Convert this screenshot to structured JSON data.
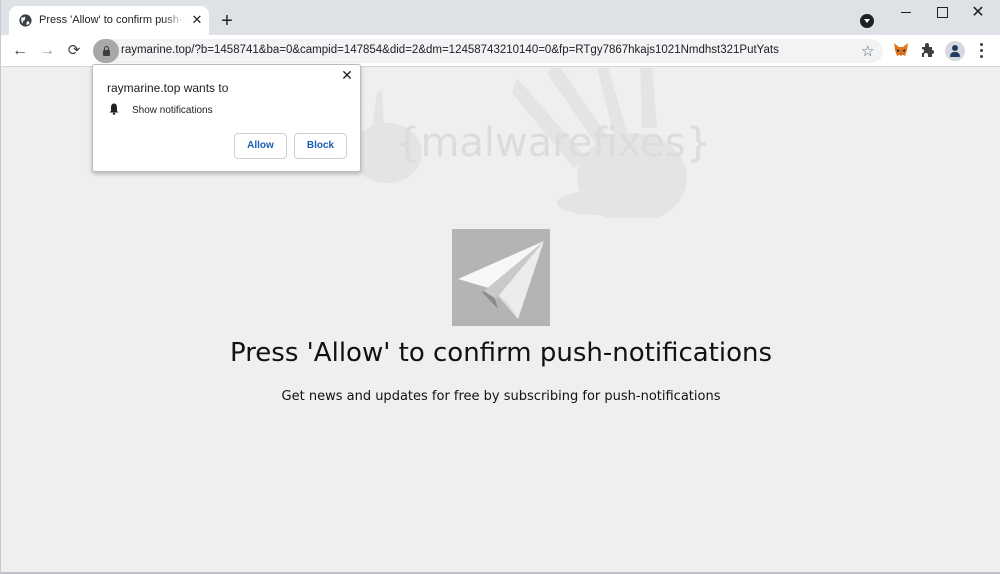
{
  "browser": {
    "tab": {
      "title": "Press 'Allow' to confirm push-notifications",
      "favicon": "globe-icon",
      "close_glyph": "✕"
    },
    "new_tab_glyph": "+",
    "window_controls": {
      "minimize": "minimize-icon",
      "maximize": "maximize-icon",
      "close_glyph": "✕"
    },
    "toolbar": {
      "back_glyph": "←",
      "forward_glyph": "→",
      "reload_glyph": "⟳",
      "url": "raymarine.top/?b=1458741&ba=0&campid=147854&did=2&dm=12458743210140=0&fp=RTgy7867hkajs1021Nmdhst321PutYats",
      "bookmark_glyph": "☆",
      "extensions": [
        "metamask-fox-icon",
        "puzzle-extensions-icon"
      ],
      "profile": "profile-avatar-icon",
      "menu": "kebab-menu-icon"
    }
  },
  "permission_popup": {
    "title": "raymarine.top wants to",
    "item_icon": "bell-icon",
    "item_label": "Show notifications",
    "allow_label": "Allow",
    "block_label": "Block",
    "close_glyph": "✕",
    "button_text_color": "#1a5fb4"
  },
  "page": {
    "watermark": "{malwarefixes}",
    "image": "paper-plane-icon",
    "headline": "Press 'Allow' to confirm push-notifications",
    "subheadline": "Get news and updates for free by subscribing for push-notifications"
  }
}
